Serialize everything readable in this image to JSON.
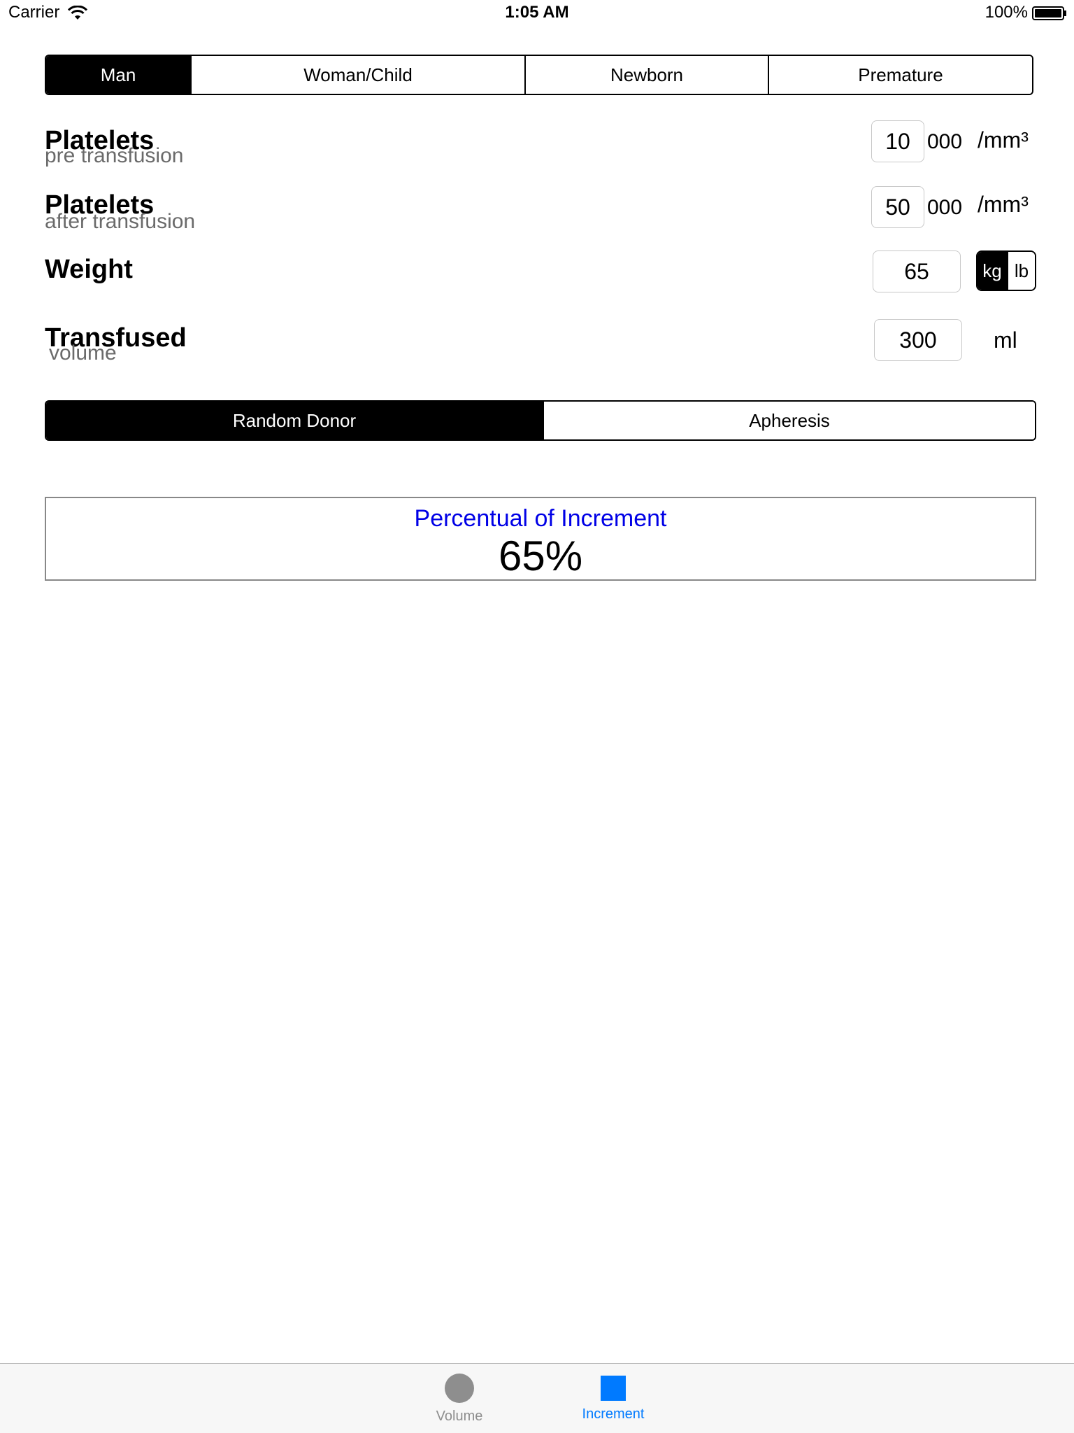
{
  "status_bar": {
    "carrier": "Carrier",
    "time": "1:05 AM",
    "battery": "100%"
  },
  "patient_type": {
    "options": [
      "Man",
      "Woman/Child",
      "Newborn",
      "Premature"
    ],
    "selected": "Man"
  },
  "platelets_pre": {
    "label": "Platelets",
    "sublabel": "pre transfusion",
    "value": "10",
    "suffix": "000",
    "unit": "/mm³"
  },
  "platelets_after": {
    "label": "Platelets",
    "sublabel": "after transfusion",
    "value": "50",
    "suffix": "000",
    "unit": "/mm³"
  },
  "weight": {
    "label": "Weight",
    "value": "65",
    "units": [
      "kg",
      "lb"
    ],
    "selected_unit": "kg"
  },
  "transfused": {
    "label": "Transfused",
    "sublabel": "volume",
    "value": "300",
    "unit": "ml"
  },
  "donor_type": {
    "options": [
      "Random Donor",
      "Apheresis"
    ],
    "selected": "Random Donor"
  },
  "result": {
    "title": "Percentual of Increment",
    "value": "65%"
  },
  "tab_bar": {
    "tabs": [
      {
        "label": "Volume",
        "icon": "circle-icon"
      },
      {
        "label": "Increment",
        "icon": "square-icon"
      }
    ],
    "selected": "Increment"
  },
  "colors": {
    "accent": "#007aff",
    "result_title": "#0000e6",
    "inactive_tab": "#8e8e8e"
  }
}
